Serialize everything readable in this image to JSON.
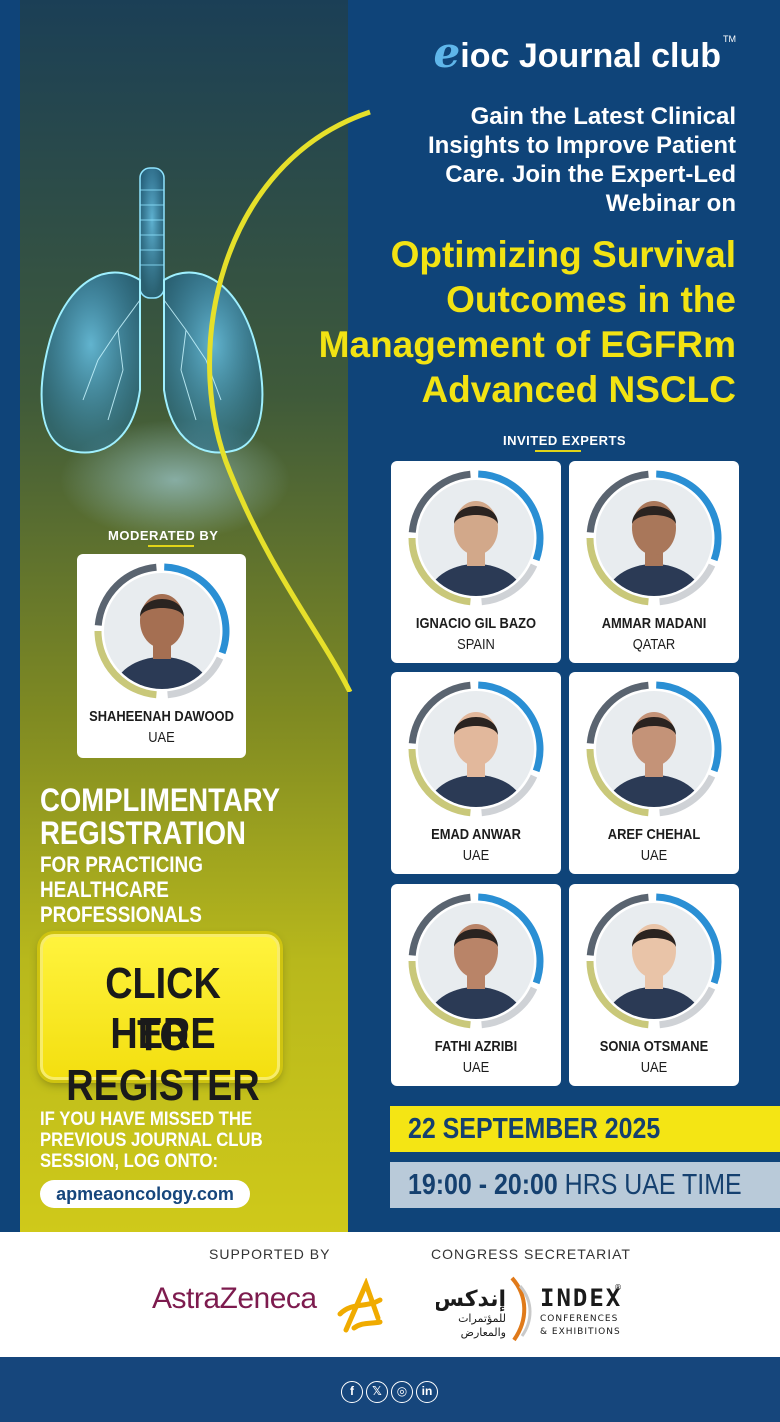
{
  "header": {
    "logo_e": "e",
    "logo_brand": "ioc Journal club",
    "logo_tm": "TM",
    "intro_lines": [
      "Gain the Latest Clinical",
      "Insights to Improve Patient",
      "Care. Join the Expert-Led",
      "Webinar on"
    ],
    "topic_lines": [
      "Optimizing Survival",
      "Outcomes in the",
      "Management of EGFRm",
      "Advanced NSCLC"
    ]
  },
  "moderator": {
    "label": "MODERATED BY",
    "name": "SHAHEENAH DAWOOD",
    "country": "UAE"
  },
  "experts": {
    "label": "INVITED EXPERTS",
    "items": [
      {
        "name": "IGNACIO GIL BAZO",
        "country": "SPAIN"
      },
      {
        "name": "AMMAR MADANI",
        "country": "QATAR"
      },
      {
        "name": "EMAD ANWAR",
        "country": "UAE"
      },
      {
        "name": "AREF CHEHAL",
        "country": "UAE"
      },
      {
        "name": "FATHI AZRIBI",
        "country": "UAE"
      },
      {
        "name": "SONIA OTSMANE",
        "country": "UAE"
      }
    ]
  },
  "registration": {
    "title_lines": [
      "COMPLIMENTARY",
      "REGISTRATION"
    ],
    "subtitle_lines": [
      "FOR PRACTICING HEALTHCARE",
      "PROFESSIONALS"
    ],
    "cta_line1": "CLICK HERE",
    "cta_line2": "TO REGISTER"
  },
  "previous": {
    "lines": [
      "IF YOU HAVE MISSED THE",
      "PREVIOUS JOURNAL CLUB",
      "SESSION, LOG ONTO:"
    ],
    "site": "apmeaoncology.com"
  },
  "schedule": {
    "date": "22 SEPTEMBER 2025",
    "time": "19:00 - 20:00",
    "time_suffix": "HRS UAE TIME"
  },
  "footer": {
    "supported_by": "SUPPORTED BY",
    "secretariat": "CONGRESS SECRETARIAT",
    "sponsor": "AstraZeneca",
    "index_arabic": "إندكس",
    "index_arabic_sub1": "للمؤتمرات",
    "index_arabic_sub2": "والمعارض",
    "index_word": "INDEX",
    "index_sub1": "CONFERENCES",
    "index_sub2": "& EXHIBITIONS",
    "index_reg": "®"
  },
  "social": [
    "facebook-icon",
    "x-icon",
    "instagram-icon",
    "linkedin-icon"
  ],
  "colors": {
    "navy": "#0f4479",
    "yellow": "#f4e514",
    "light_blue": "#b9cad9",
    "accent_blue": "#2a8fd4",
    "astrazeneca": "#7d1b4e",
    "astrazeneca_mark": "#f0ab00"
  }
}
